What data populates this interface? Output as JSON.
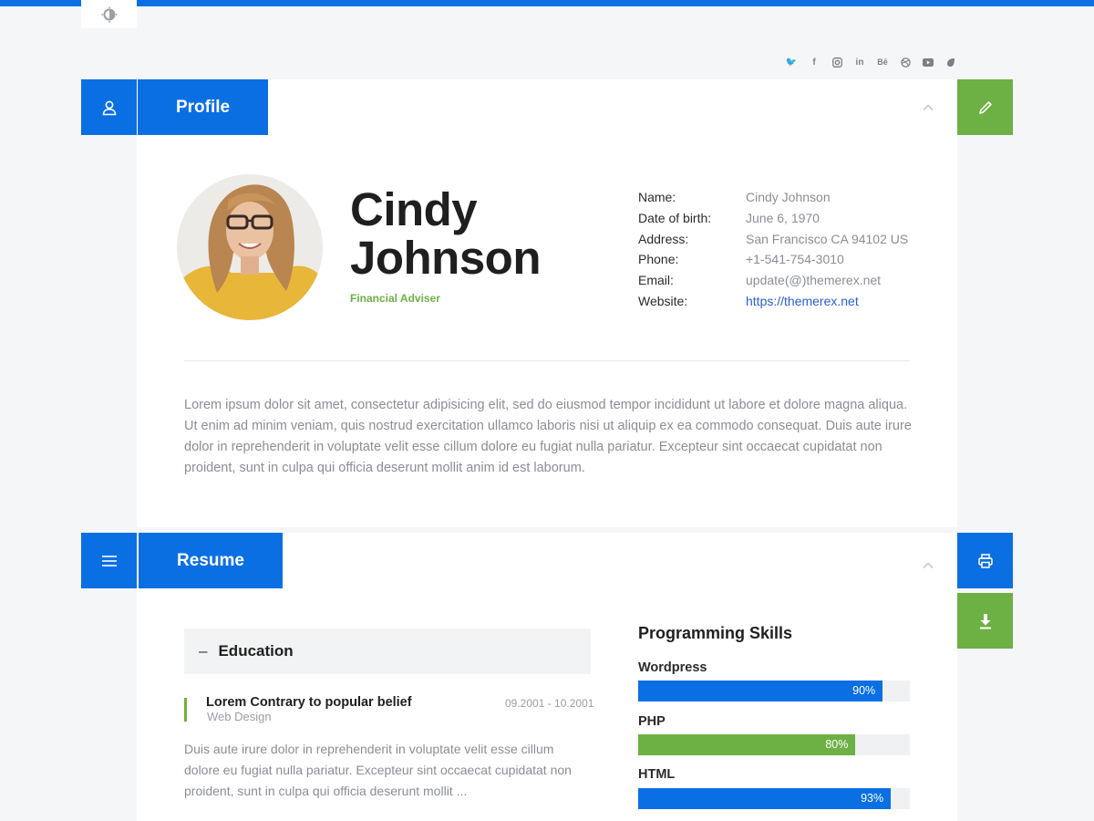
{
  "colors": {
    "accent": "#0b6fe4",
    "green": "#6db044"
  },
  "theme_toggle": {
    "icon": "contrast-icon"
  },
  "social": {
    "icons": [
      "twitter-icon",
      "facebook-icon",
      "instagram-icon",
      "linkedin-icon",
      "behance-icon",
      "dribbble-icon",
      "youtube-icon",
      "leaf-icon"
    ]
  },
  "profile": {
    "tab_label": "Profile",
    "first_name": "Cindy",
    "last_name": "Johnson",
    "role": "Financial Adviser",
    "info": [
      {
        "key": "Name:",
        "value": "Cindy Johnson"
      },
      {
        "key": "Date of birth:",
        "value": "June 6, 1970"
      },
      {
        "key": "Address:",
        "value": "San Francisco CA 94102 US"
      },
      {
        "key": "Phone:",
        "value": "+1-541-754-3010"
      },
      {
        "key": "Email:",
        "value": "update(@)themerex.net"
      },
      {
        "key": "Website:",
        "value": "https://themerex.net"
      }
    ],
    "bio": "Lorem ipsum dolor sit amet, consectetur adipisicing elit, sed do eiusmod tempor incididunt ut labore et dolore magna aliqua. Ut enim ad minim veniam, quis nostrud exercitation ullamco laboris nisi ut aliquip ex ea commodo consequat. Duis aute irure dolor in reprehenderit in voluptate velit esse cillum dolore eu fugiat nulla pariatur. Excepteur sint occaecat cupidatat non proident, sunt in culpa qui officia deserunt mollit anim id est laborum."
  },
  "resume": {
    "tab_label": "Resume",
    "education": {
      "heading": "Education",
      "toggle": "–",
      "entry": {
        "title": "Lorem Contrary to popular belief",
        "subtitle": "Web Design",
        "date": "09.2001 - 10.2001",
        "text": "Duis aute irure dolor in reprehenderit in voluptate velit esse cillum dolore eu fugiat nulla pariatur. Excepteur sint occaecat cupidatat non proident, sunt in culpa qui officia deserunt mollit ..."
      }
    },
    "skills": {
      "title": "Programming Skills",
      "items": [
        {
          "name": "Wordpress",
          "percent": 90,
          "label": "90%",
          "color": "#0b6fe4"
        },
        {
          "name": "PHP",
          "percent": 80,
          "label": "80%",
          "color": "#6db044"
        },
        {
          "name": "HTML",
          "percent": 93,
          "label": "93%",
          "color": "#0b6fe4"
        }
      ]
    }
  }
}
